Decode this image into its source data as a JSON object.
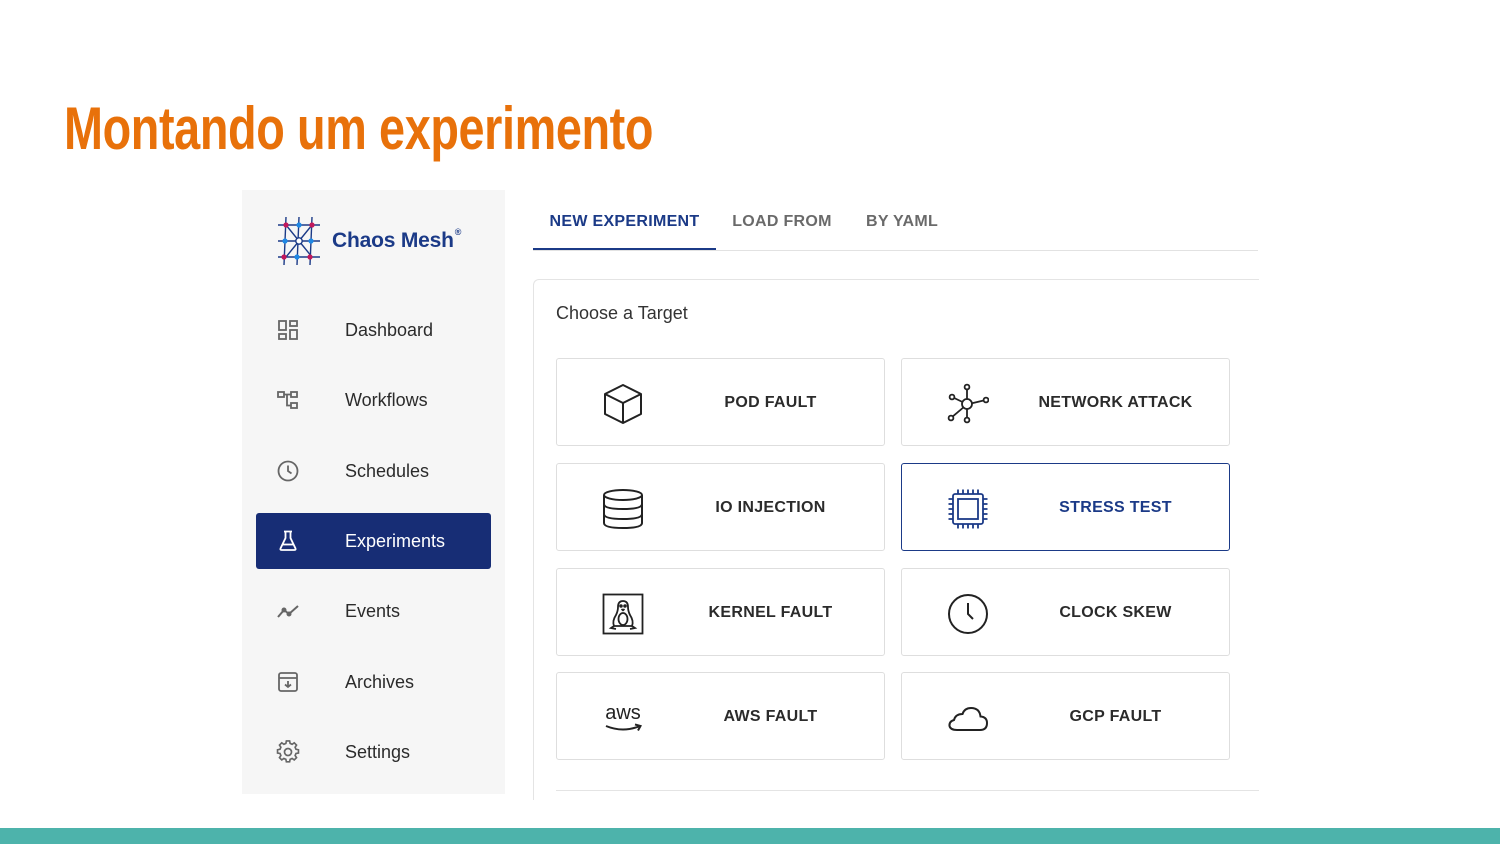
{
  "slide": {
    "title": "Montando um experimento"
  },
  "app": {
    "brand": {
      "name": "Chaos Mesh",
      "mark": "®"
    },
    "sidebar": {
      "items": [
        {
          "label": "Dashboard",
          "icon": "dashboard-icon"
        },
        {
          "label": "Workflows",
          "icon": "workflows-icon"
        },
        {
          "label": "Schedules",
          "icon": "clock-icon"
        },
        {
          "label": "Experiments",
          "icon": "flask-icon",
          "active": true
        },
        {
          "label": "Events",
          "icon": "trend-line-icon"
        },
        {
          "label": "Archives",
          "icon": "archive-icon"
        },
        {
          "label": "Settings",
          "icon": "gear-icon"
        }
      ]
    },
    "tabs": [
      {
        "label": "NEW EXPERIMENT",
        "active": true
      },
      {
        "label": "LOAD FROM"
      },
      {
        "label": "BY YAML"
      }
    ],
    "panel": {
      "title": "Choose a Target",
      "targets": [
        {
          "label": "POD FAULT",
          "icon": "cube-icon"
        },
        {
          "label": "NETWORK ATTACK",
          "icon": "network-icon"
        },
        {
          "label": "IO INJECTION",
          "icon": "database-icon"
        },
        {
          "label": "STRESS TEST",
          "icon": "cpu-icon",
          "selected": true
        },
        {
          "label": "KERNEL FAULT",
          "icon": "linux-icon"
        },
        {
          "label": "CLOCK SKEW",
          "icon": "clock-icon"
        },
        {
          "label": "AWS FAULT",
          "icon": "aws-icon",
          "icon_text": "aws"
        },
        {
          "label": "GCP FAULT",
          "icon": "cloud-icon"
        }
      ]
    }
  },
  "colors": {
    "title_orange": "#e8710a",
    "brand_navy": "#1b3a87",
    "active_nav": "#172d75",
    "footer_teal": "#4db3ab"
  }
}
